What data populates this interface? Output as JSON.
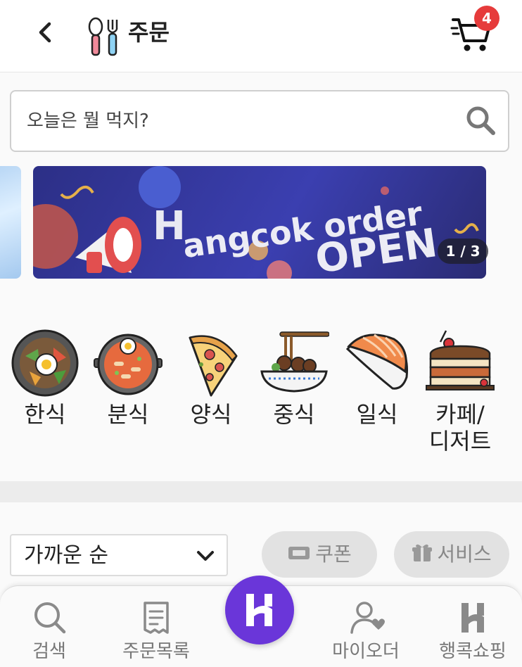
{
  "header": {
    "title": "주문",
    "cart_count": "4"
  },
  "search": {
    "placeholder": "오늘은 뭘 먹지?"
  },
  "banner": {
    "text_line1": "angcok order",
    "text_line2": "OPEN",
    "counter": "1 / 3"
  },
  "categories": [
    {
      "label": "한식",
      "icon": "bibimbap-icon"
    },
    {
      "label": "분식",
      "icon": "tteokbokki-pan-icon"
    },
    {
      "label": "양식",
      "icon": "pizza-slice-icon"
    },
    {
      "label": "중식",
      "icon": "noodle-bowl-icon"
    },
    {
      "label": "일식",
      "icon": "sushi-icon"
    },
    {
      "label": "카페/\n디저트",
      "icon": "cake-dessert-icon"
    }
  ],
  "filters": {
    "sort_label": "가까운 순",
    "coupon_label": "쿠폰",
    "service_label": "서비스"
  },
  "bottom_nav": [
    {
      "label": "검색",
      "icon": "search-icon"
    },
    {
      "label": "주문목록",
      "icon": "receipt-icon"
    },
    {
      "label": "",
      "icon": "hangcok-logo-icon"
    },
    {
      "label": "마이오더",
      "icon": "user-heart-icon"
    },
    {
      "label": "행콕쇼핑",
      "icon": "hangcok-h-icon"
    }
  ],
  "colors": {
    "badge": "#e63b3b",
    "home_button": "#6a36d9",
    "banner_bg": "#2c2f86"
  }
}
